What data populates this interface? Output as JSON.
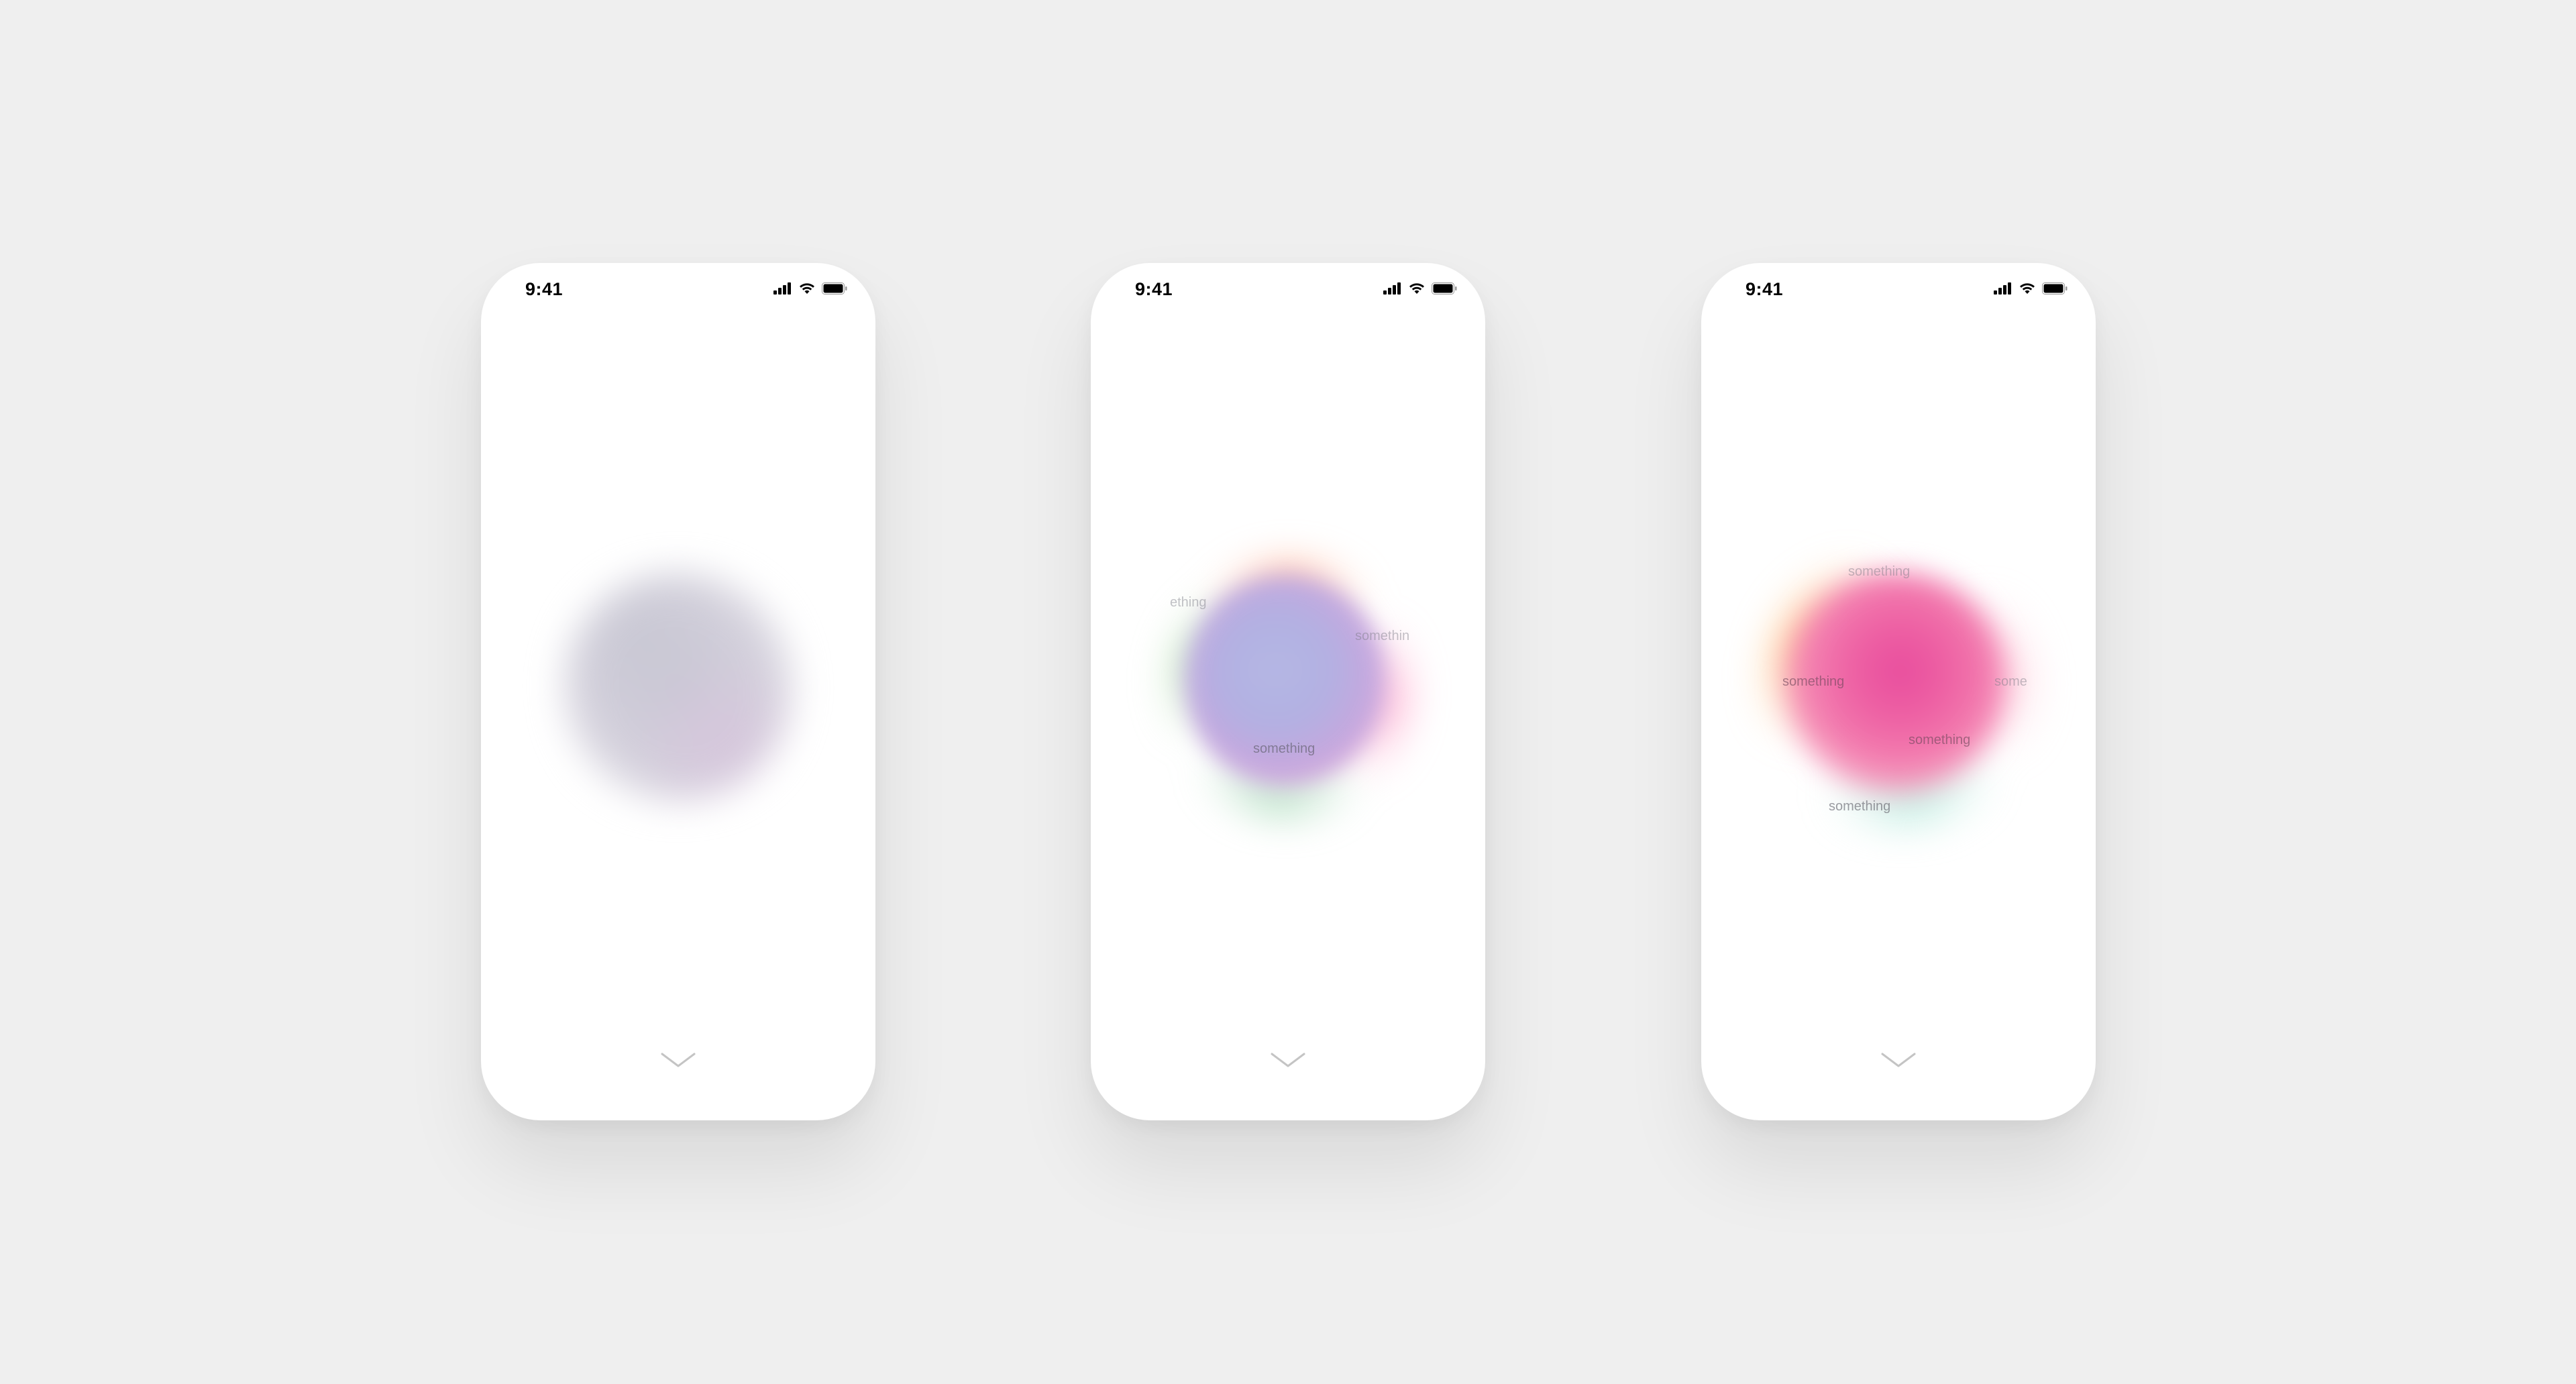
{
  "phones": [
    {
      "status": {
        "time": "9:41"
      },
      "orb": {
        "style": "gray",
        "labels": []
      }
    },
    {
      "status": {
        "time": "9:41"
      },
      "orb": {
        "style": "purple",
        "labels": [
          "ething",
          "somethin",
          "something"
        ]
      }
    },
    {
      "status": {
        "time": "9:41"
      },
      "orb": {
        "style": "pink",
        "labels": [
          "something",
          "something",
          "some",
          "something",
          "something"
        ]
      }
    }
  ],
  "icons": {
    "signal": "cellular-signal-icon",
    "wifi": "wifi-icon",
    "battery": "battery-icon",
    "chevron": "chevron-down-icon"
  },
  "colors": {
    "background": "#efefef",
    "phone": "#ffffff",
    "pink_orb": "#e84c9d",
    "purple_orb": "#b4b7e4",
    "gray_orb": "#cbc7d6"
  }
}
